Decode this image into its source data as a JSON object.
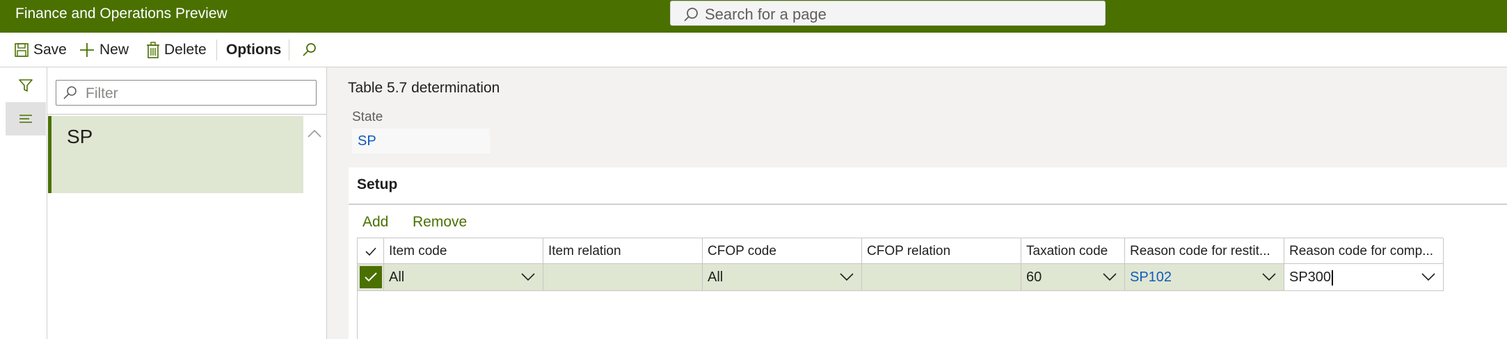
{
  "app": {
    "title": "Finance and Operations Preview"
  },
  "search": {
    "placeholder": "Search for a page"
  },
  "actions": {
    "save": "Save",
    "new": "New",
    "delete": "Delete",
    "options": "Options"
  },
  "list": {
    "filter_placeholder": "Filter",
    "items": [
      {
        "label": "SP",
        "selected": true
      }
    ]
  },
  "details": {
    "title": "Table 5.7 determination",
    "state_label": "State",
    "state_value": "SP"
  },
  "setup": {
    "title": "Setup",
    "add": "Add",
    "remove": "Remove",
    "columns": [
      "Item code",
      "Item relation",
      "CFOP code",
      "CFOP relation",
      "Taxation code",
      "Reason code for restit...",
      "Reason code for comp..."
    ],
    "rows": [
      {
        "item_code": "All",
        "item_relation": "",
        "cfop_code": "All",
        "cfop_relation": "",
        "taxation_code": "60",
        "reason_restit": "SP102",
        "reason_comp": "SP300"
      }
    ]
  },
  "colors": {
    "brand": "#4a7000",
    "selected_row": "#dfe6d2",
    "link": "#0f5bbf"
  }
}
